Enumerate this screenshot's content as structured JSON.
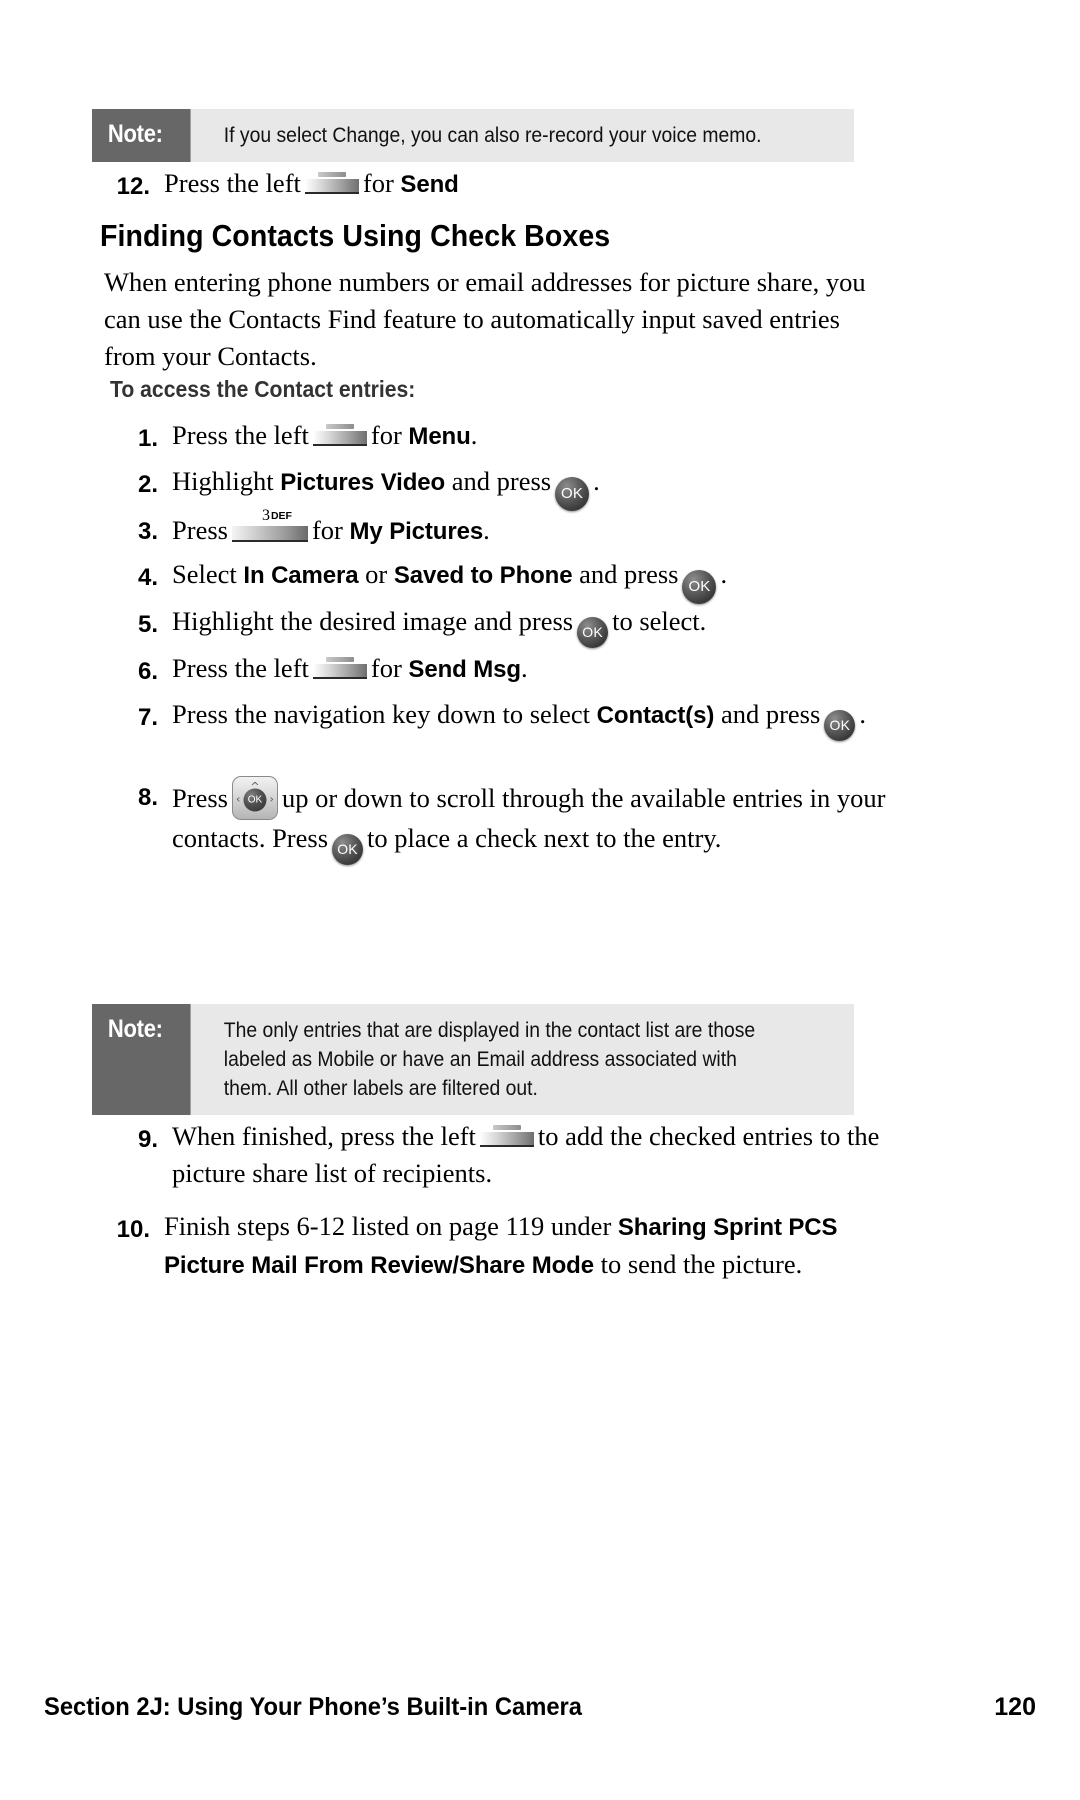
{
  "notes": [
    {
      "label": "Note:",
      "text": "If you select Change, you can also re-record your voice memo."
    },
    {
      "label": "Note:",
      "text": "The only entries that are displayed in the contact list are those labeled as Mobile or have an Email address associated with them. All other labels are filtered out."
    }
  ],
  "step12": {
    "num": "12.",
    "before": "Press the left",
    "mid": "for",
    "ui": "Send",
    "softkey_icon": "softkey-icon"
  },
  "heading": "Finding Contacts Using Check Boxes",
  "intro_paragraph": "When entering phone numbers or email addresses for picture share, you can use the Contacts Find feature to automatically input saved entries from your Contacts.",
  "sub_heading": "To access the Contact entries:",
  "steps": [
    {
      "num": "1.",
      "p1": "Press the left",
      "icon": "softkey-icon",
      "p2": "for",
      "ui1": "Menu",
      "p3": "."
    },
    {
      "num": "2.",
      "p1": "Highlight",
      "ui1": "Pictures Video",
      "p2": "and press",
      "icon": "ok-button-icon",
      "icon_label": "OK",
      "p3": "."
    },
    {
      "num": "3.",
      "p1": "Press",
      "icon": "key-3-def-icon",
      "icon_label": "3",
      "icon_sublabel": "DEF",
      "p2": "for",
      "ui1": "My Pictures",
      "p3": "."
    },
    {
      "num": "4.",
      "p1": "Select",
      "ui1": "In Camera",
      "p2": "or",
      "ui2": "Saved to Phone",
      "p3": "and press",
      "icon": "ok-button-icon",
      "icon_label": "OK",
      "p4": "."
    },
    {
      "num": "5.",
      "p1": "Highlight the desired image and press",
      "icon": "ok-button-icon",
      "icon_label": "OK",
      "p2": "to select."
    },
    {
      "num": "6.",
      "p1": "Press the left",
      "icon": "softkey-icon",
      "p2": "for",
      "ui1": "Send Msg",
      "p3": "."
    },
    {
      "num": "7.",
      "p1": "Press the navigation key down to select",
      "ui1": "Contact(s)",
      "p2": "and press",
      "icon": "ok-button-icon",
      "icon_label": "OK",
      "p3": "."
    },
    {
      "num": "8.",
      "p1": "Press",
      "icon": "navigation-key-icon",
      "icon_label": "OK",
      "p2": "up or down to scroll through the available entries in your contacts. Press",
      "icon2": "ok-button-icon",
      "icon2_label": "OK",
      "p3": "to place a check next to the entry."
    },
    {
      "num": "9.",
      "p1": "When finished, press the left",
      "icon": "softkey-icon",
      "p2": "to add the checked entries to the picture share list of recipients."
    },
    {
      "num": "10.",
      "p1": "Finish steps 6-12 listed on page 119  under",
      "ui1": "Sharing Sprint PCS Picture Mail From Review/Share Mode",
      "p2": "to send the picture."
    }
  ],
  "footer": {
    "title": "Section 2J: Using Your Phone’s Built-in Camera",
    "page": "120"
  },
  "colors": {
    "note_label_bg": "#676767",
    "note_body_bg": "#e8e8e8",
    "subheading": "#333333",
    "text": "#000000"
  }
}
